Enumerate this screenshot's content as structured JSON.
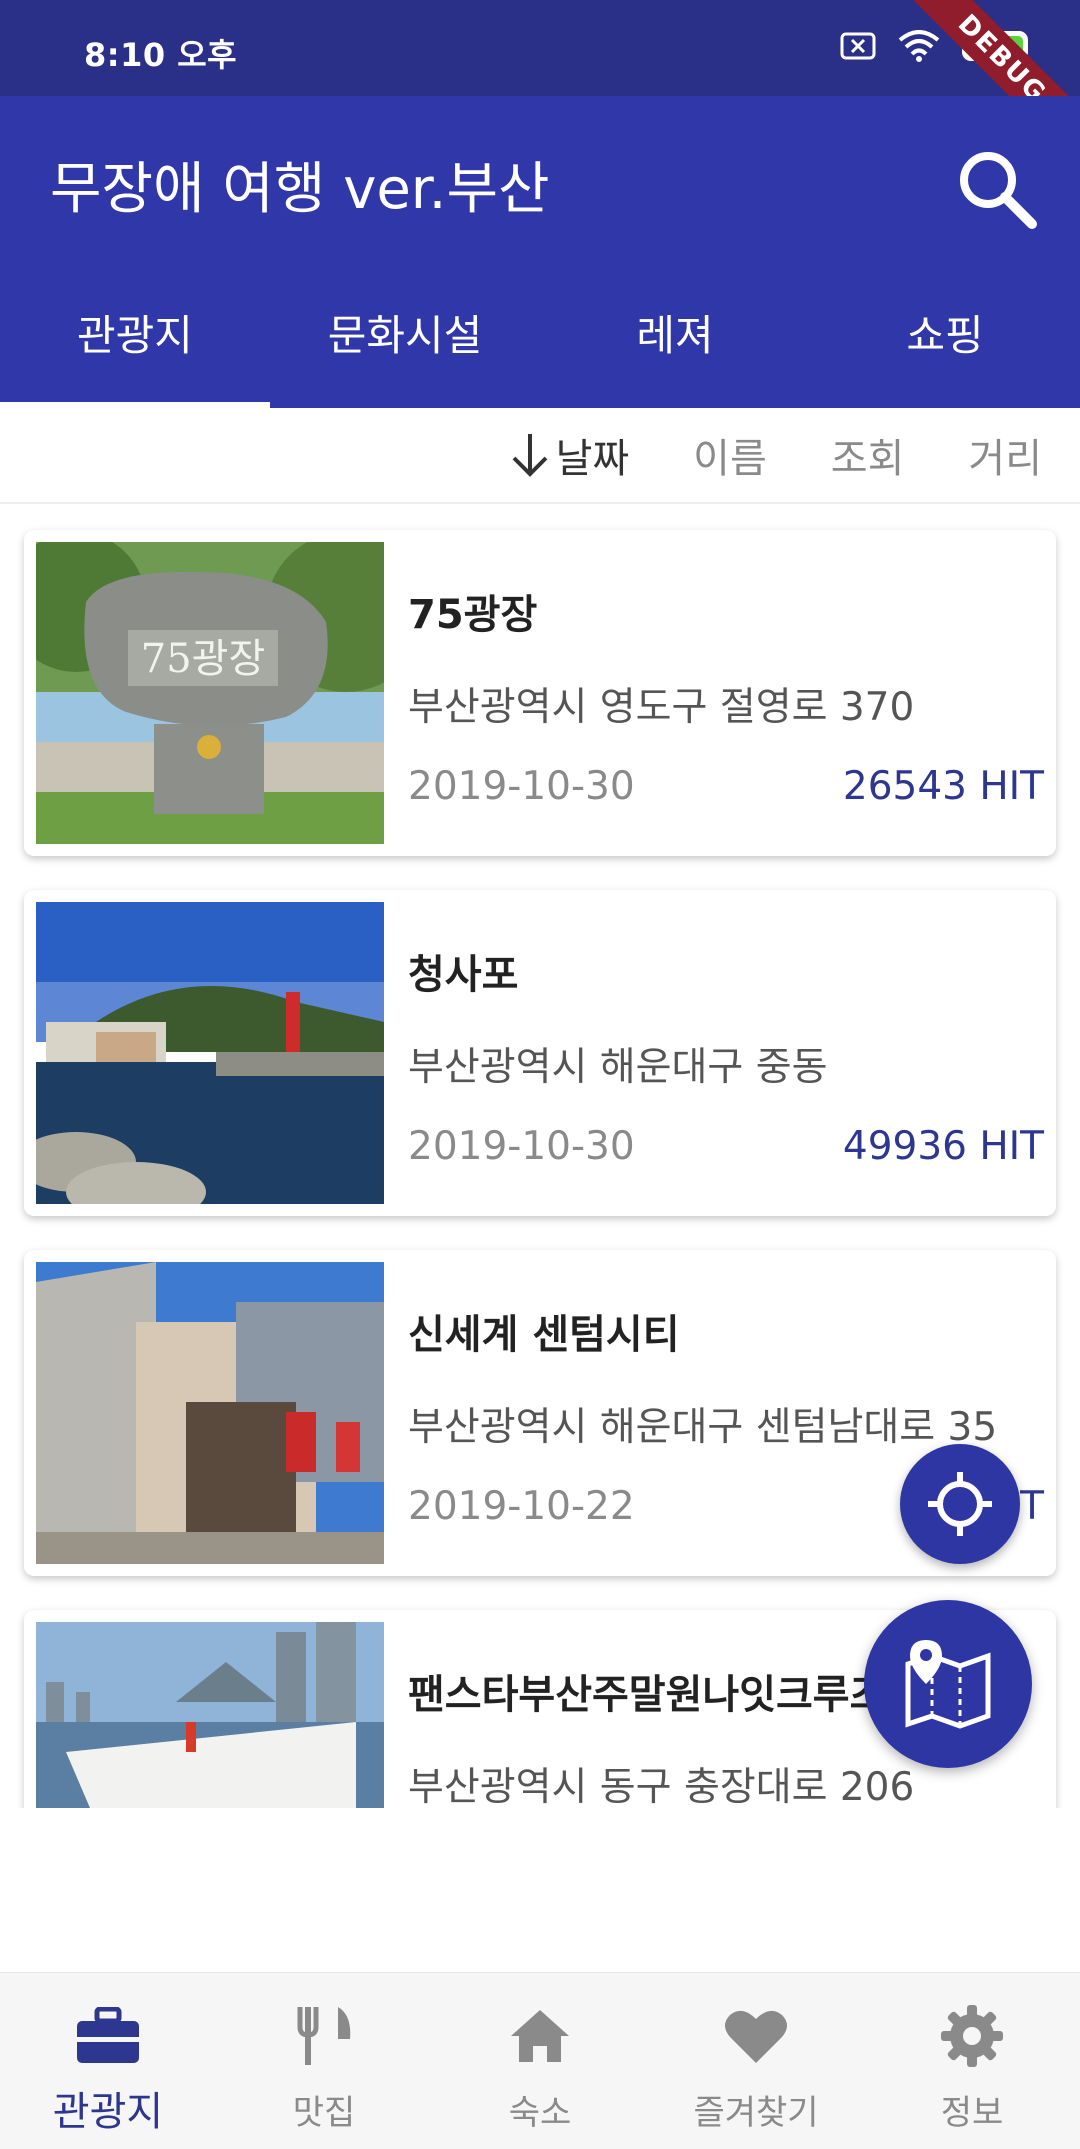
{
  "status_bar": {
    "time": "8:10 오후",
    "battery": "97",
    "debug_label": "DEBUG"
  },
  "app_bar": {
    "title": "무장애 여행 ver.부산"
  },
  "tabs": [
    {
      "label": "관광지",
      "active": true
    },
    {
      "label": "문화시설",
      "active": false
    },
    {
      "label": "레져",
      "active": false
    },
    {
      "label": "쇼핑",
      "active": false
    }
  ],
  "sort": {
    "items": [
      {
        "label": "날짜",
        "active": true,
        "direction": "down"
      },
      {
        "label": "이름",
        "active": false
      },
      {
        "label": "조회",
        "active": false
      },
      {
        "label": "거리",
        "active": false
      }
    ]
  },
  "places": [
    {
      "title": "75광장",
      "address": "부산광역시 영도구 절영로 370",
      "date": "2019-10-30",
      "hits": "26543 HIT",
      "image_text": "75광장"
    },
    {
      "title": "청사포",
      "address": "부산광역시 해운대구 중동",
      "date": "2019-10-30",
      "hits": "49936 HIT"
    },
    {
      "title": "신세계 센텀시티",
      "address": "부산광역시 해운대구 센텀남대로 35",
      "date": "2019-10-22",
      "hits": "43 HIT"
    },
    {
      "title": "팬스타부산주말원나잇크루즈",
      "address": "부산광역시 동구 충장대로 206",
      "date": "",
      "hits": ""
    }
  ],
  "bottom_nav": [
    {
      "label": "관광지",
      "icon": "briefcase-icon",
      "active": true
    },
    {
      "label": "맛집",
      "icon": "utensils-icon",
      "active": false
    },
    {
      "label": "숙소",
      "icon": "home-icon",
      "active": false
    },
    {
      "label": "즐겨찾기",
      "icon": "heart-icon",
      "active": false
    },
    {
      "label": "정보",
      "icon": "gear-icon",
      "active": false
    }
  ],
  "colors": {
    "primary": "#3037a8",
    "status_bar": "#2a3088",
    "accent_text": "#2e3790",
    "fab": "#2e36a4"
  }
}
